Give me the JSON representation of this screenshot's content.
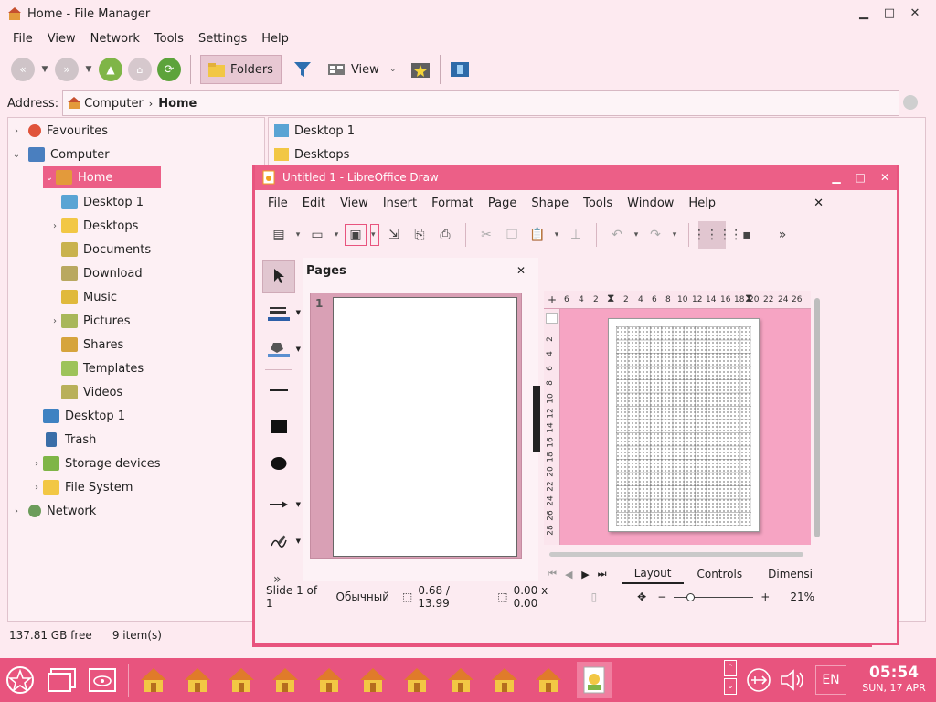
{
  "file_manager": {
    "title": "Home - File Manager",
    "menu": [
      "File",
      "View",
      "Network",
      "Tools",
      "Settings",
      "Help"
    ],
    "toolbar": {
      "folders_label": "Folders",
      "view_label": "View"
    },
    "address": {
      "label": "Address:",
      "crumbs": [
        "Computer",
        "Home"
      ]
    },
    "tree": {
      "favourites": "Favourites",
      "computer": "Computer",
      "home": "Home",
      "home_children": [
        "Desktop 1",
        "Desktops",
        "Documents",
        "Download",
        "Music",
        "Pictures",
        "Shares",
        "Templates",
        "Videos"
      ],
      "computer_children": [
        "Desktop 1",
        "Trash",
        "Storage devices",
        "File System"
      ],
      "network": "Network"
    },
    "list_items": [
      "Desktop 1",
      "Desktops"
    ],
    "status": {
      "free": "137.81 GB free",
      "count": "9 item(s)"
    }
  },
  "draw": {
    "title": "Untitled 1 - LibreOffice Draw",
    "menu": [
      "File",
      "Edit",
      "View",
      "Insert",
      "Format",
      "Page",
      "Shape",
      "Tools",
      "Window",
      "Help"
    ],
    "pages_panel": {
      "title": "Pages",
      "page_number": "1"
    },
    "h_ruler": [
      "6",
      "4",
      "2",
      "2",
      "4",
      "6",
      "8",
      "10",
      "12",
      "14",
      "16",
      "18",
      "20",
      "22",
      "24",
      "26"
    ],
    "v_ruler": [
      "2",
      "4",
      "6",
      "8",
      "10",
      "12",
      "14",
      "16",
      "18",
      "20",
      "22",
      "24",
      "26",
      "28"
    ],
    "tabs": [
      "Layout",
      "Controls",
      "Dimensi"
    ],
    "status": {
      "slide": "Slide 1 of 1",
      "style": "Обычный",
      "position": "0.68 / 13.99",
      "size": "0.00 x 0.00",
      "zoom": "21%"
    }
  },
  "taskbar": {
    "lang": "EN",
    "time": "05:54",
    "date": "SUN, 17 APR",
    "colors": {
      "bar": "#e8547e",
      "accent": "#ec5f87"
    }
  }
}
